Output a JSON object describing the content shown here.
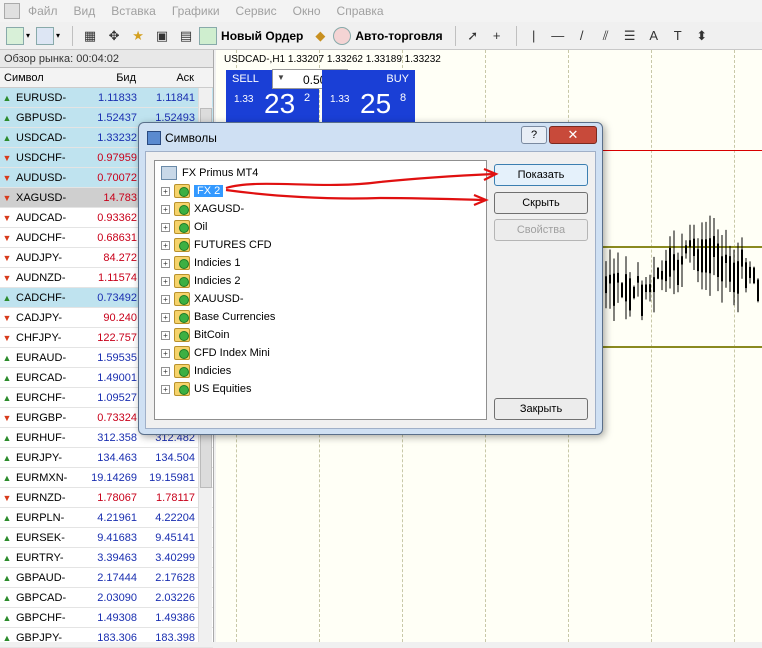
{
  "menu": [
    "Файл",
    "Вид",
    "Вставка",
    "Графики",
    "Сервис",
    "Окно",
    "Справка"
  ],
  "toolbar": {
    "new_order": "Новый Ордер",
    "auto_trading": "Авто-торговля"
  },
  "market_watch": {
    "title": "Обзор рынка: 00:04:02",
    "headers": {
      "symbol": "Символ",
      "bid": "Бид",
      "ask": "Аск"
    },
    "rows": [
      {
        "s": "EURUSD-",
        "b": "1.11833",
        "a": "1.11841",
        "d": "up",
        "h": "hl"
      },
      {
        "s": "GBPUSD-",
        "b": "1.52437",
        "a": "1.52493",
        "d": "up",
        "h": "hl"
      },
      {
        "s": "USDCAD-",
        "b": "1.33232",
        "a": "",
        "d": "up",
        "h": "hl"
      },
      {
        "s": "USDCHF-",
        "b": "0.97959",
        "a": "",
        "d": "down",
        "h": "hl"
      },
      {
        "s": "AUDUSD-",
        "b": "0.70072",
        "a": "",
        "d": "down",
        "h": "hl"
      },
      {
        "s": "XAGUSD-",
        "b": "14.783",
        "a": "",
        "d": "down",
        "h": "sel"
      },
      {
        "s": "AUDCAD-",
        "b": "0.93362",
        "a": "",
        "d": "down",
        "h": ""
      },
      {
        "s": "AUDCHF-",
        "b": "0.68631",
        "a": "",
        "d": "down",
        "h": ""
      },
      {
        "s": "AUDJPY-",
        "b": "84.272",
        "a": "",
        "d": "down",
        "h": ""
      },
      {
        "s": "AUDNZD-",
        "b": "1.11574",
        "a": "",
        "d": "down",
        "h": ""
      },
      {
        "s": "CADCHF-",
        "b": "0.73492",
        "a": "",
        "d": "up",
        "h": "hl"
      },
      {
        "s": "CADJPY-",
        "b": "90.240",
        "a": "",
        "d": "down",
        "h": ""
      },
      {
        "s": "CHFJPY-",
        "b": "122.757",
        "a": "",
        "d": "down",
        "h": ""
      },
      {
        "s": "EURAUD-",
        "b": "1.59535",
        "a": "",
        "d": "up",
        "h": ""
      },
      {
        "s": "EURCAD-",
        "b": "1.49001",
        "a": "",
        "d": "up",
        "h": ""
      },
      {
        "s": "EURCHF-",
        "b": "1.09527",
        "a": "",
        "d": "up",
        "h": ""
      },
      {
        "s": "EURGBP-",
        "b": "0.73324",
        "a": "",
        "d": "down",
        "h": ""
      },
      {
        "s": "EURHUF-",
        "b": "312.358",
        "a": "312.482",
        "d": "up",
        "h": ""
      },
      {
        "s": "EURJPY-",
        "b": "134.463",
        "a": "134.504",
        "d": "up",
        "h": ""
      },
      {
        "s": "EURMXN-",
        "b": "19.14269",
        "a": "19.15981",
        "d": "up",
        "h": ""
      },
      {
        "s": "EURNZD-",
        "b": "1.78067",
        "a": "1.78117",
        "d": "down",
        "h": ""
      },
      {
        "s": "EURPLN-",
        "b": "4.21961",
        "a": "4.22204",
        "d": "up",
        "h": ""
      },
      {
        "s": "EURSEK-",
        "b": "9.41683",
        "a": "9.45141",
        "d": "up",
        "h": ""
      },
      {
        "s": "EURTRY-",
        "b": "3.39463",
        "a": "3.40299",
        "d": "up",
        "h": ""
      },
      {
        "s": "GBPAUD-",
        "b": "2.17444",
        "a": "2.17628",
        "d": "up",
        "h": ""
      },
      {
        "s": "GBPCAD-",
        "b": "2.03090",
        "a": "2.03226",
        "d": "up",
        "h": ""
      },
      {
        "s": "GBPCHF-",
        "b": "1.49308",
        "a": "1.49386",
        "d": "up",
        "h": ""
      },
      {
        "s": "GBPJPY-",
        "b": "183.306",
        "a": "183.398",
        "d": "up",
        "h": ""
      }
    ]
  },
  "chart": {
    "title": "USDCAD-,H1  1.33207 1.33262 1.33189 1.33232",
    "sell_label": "SELL",
    "buy_label": "BUY",
    "lot": "0.50",
    "sell_prefix": "1.33",
    "sell_big": "23",
    "sell_sup": "2",
    "buy_prefix": "1.33",
    "buy_big": "25",
    "buy_sup": "8"
  },
  "dialog": {
    "title": "Символы",
    "help": "?",
    "close": "✕",
    "tree_root": "FX Primus MT4",
    "tree_items": [
      "FX 2",
      "XAGUSD-",
      "Oil",
      "FUTURES CFD",
      "Indicies 1",
      "Indicies 2",
      "XAUUSD-",
      "Base Currencies",
      "BitCoin",
      "CFD Index Mini",
      "Indicies",
      "US Equities"
    ],
    "btn_show": "Показать",
    "btn_hide": "Скрыть",
    "btn_props": "Свойства",
    "btn_close": "Закрыть"
  }
}
